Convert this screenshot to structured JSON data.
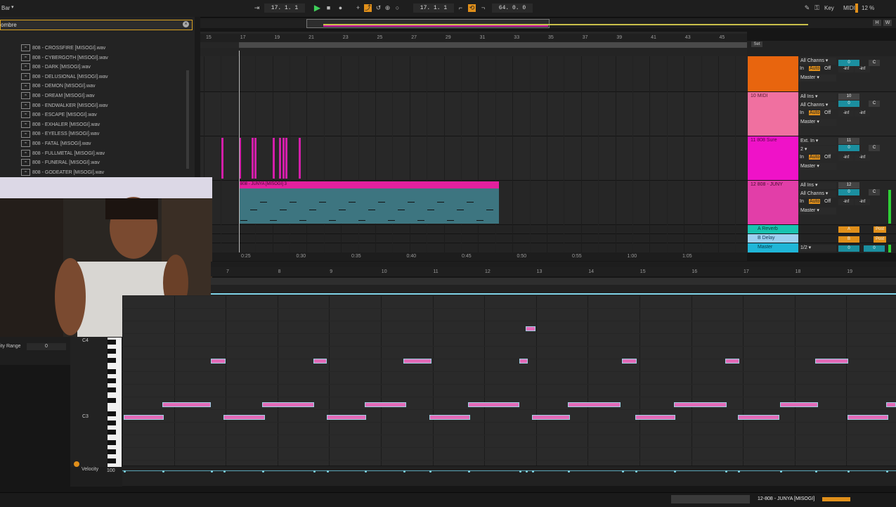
{
  "transport": {
    "top_left": "Bar",
    "position1": "17. 1. 1",
    "position2": "17. 1. 1",
    "loop_length": "64. 0. 0",
    "key_label": "Key",
    "midi_label": "MIDI",
    "cpu": "12 %",
    "h_label": "H",
    "w_label": "W"
  },
  "browser": {
    "header": "ombre",
    "items": [
      "808 - CROSSFIRE [MISOGI].wav",
      "808 - CYBERGOTH [MISOGI].wav",
      "808 - DARK [MISOGI].wav",
      "808 - DELUSIONAL [MISOGI].wav",
      "808 - DEMON [MISOGI].wav",
      "808 - DREAM [MISOGI].wav",
      "808 - ENDWALKER [MISOGI].wav",
      "808 - ESCAPE [MISOGI].wav",
      "808 - EXHALER [MISOGI].wav",
      "808 - EYELESS [MISOGI].wav",
      "808 - FATAL [MISOGI].wav",
      "808 - FULLMETAL [MISOGI].wav",
      "808 - FUNERAL [MISOGI].wav",
      "808 - GODEATER [MISOGI].wav"
    ]
  },
  "ruler": [
    "15",
    "17",
    "19",
    "21",
    "23",
    "25",
    "27",
    "29",
    "31",
    "33",
    "35",
    "37",
    "39",
    "41",
    "43",
    "45"
  ],
  "time_ruler": [
    "0:25",
    "0:30",
    "0:35",
    "0:40",
    "0:45",
    "0:50",
    "0:55",
    "1:00",
    "1:05"
  ],
  "set_label": "Set",
  "tracks": [
    {
      "name": "",
      "color": "#e8650e",
      "in1": "All Channs",
      "in_auto": "In",
      "auto": "Auto",
      "off": "Off",
      "out": "Master",
      "vol": "0",
      "pan": "C",
      "inf1": "-inf",
      "inf2": "-inf"
    },
    {
      "name": "10 MIDI",
      "color": "#f070a0",
      "in0": "All Ins",
      "in1": "All Channs",
      "in_auto": "In",
      "auto": "Auto",
      "off": "Off",
      "out": "Master",
      "vol": "0",
      "pan": "C",
      "num": "10",
      "inf1": "-inf",
      "inf2": "-inf"
    },
    {
      "name": "11 808 Sure",
      "color": "#ef12c8",
      "in0": "Ext. In",
      "in1": "2",
      "in_auto": "In",
      "auto": "Auto",
      "off": "Off",
      "out": "Master",
      "vol": "0",
      "pan": "C",
      "num": "11",
      "inf1": "-inf",
      "inf2": "-inf"
    },
    {
      "name": "12 808 - JUNY",
      "color": "#e23ea8",
      "in0": "All Ins",
      "in1": "All Channs",
      "in_auto": "In",
      "auto": "Auto",
      "off": "Off",
      "out": "Master",
      "vol": "0",
      "pan": "C",
      "num": "12",
      "inf1": "-inf",
      "inf2": "-inf"
    }
  ],
  "returns": [
    {
      "name": "A Reverb",
      "color": "#19c3b0",
      "send": "A",
      "post": "Post"
    },
    {
      "name": "B Delay",
      "color": "#9dd0f0",
      "send": "B",
      "post": "Post"
    },
    {
      "name": "Master",
      "color": "#1fb6d8",
      "route": "1/2",
      "vol": "0",
      "pan": "0"
    }
  ],
  "clip_title": "808 - JUNYA [MISOGI] 3",
  "piano_ruler": [
    "7",
    "8",
    "9",
    "10",
    "11",
    "12",
    "13",
    "14",
    "15",
    "16",
    "17",
    "18",
    "19"
  ],
  "key_labels": {
    "c4": "C4",
    "c3": "C3"
  },
  "side": {
    "velocity_range_label": "ity Range",
    "velocity_range_value": "0",
    "velocity_label": "Velocity",
    "velocity_value": "100"
  },
  "status": {
    "clip_name": "12-808 - JUNYA [MISOGI]"
  },
  "colors": {
    "accent": "#d8a020",
    "note": "#e36bb8",
    "note_border": "#9fd0e4",
    "clip": "#d31fa9",
    "clip_body": "#3d7580"
  }
}
